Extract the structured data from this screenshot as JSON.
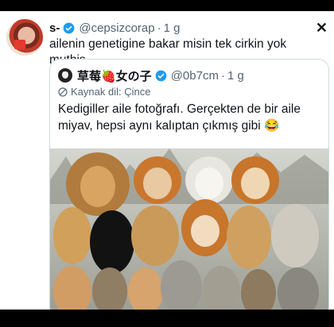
{
  "tweet": {
    "author_name": "s-",
    "author_handle": "@cepsizcorap",
    "separator": "·",
    "time": "1 g",
    "text": "ailenin genetigine bakar misin tek cirkin yok muthis",
    "close_symbol": "✕"
  },
  "quote": {
    "author_name": "草莓🍓女の子",
    "author_handle": "@0b7cm",
    "separator": "·",
    "time": "1 g",
    "source_language": "Kaynak dil: Çince",
    "text": "Kedigiller aile fotoğrafı. Gerçekten de bir aile miyav, hepsi aynı kalıptan çıkmış gibi 😂"
  },
  "colors": {
    "text": "#0f1419",
    "muted": "#536471",
    "verified": "#1d9bf0",
    "border": "#cfd9de"
  }
}
